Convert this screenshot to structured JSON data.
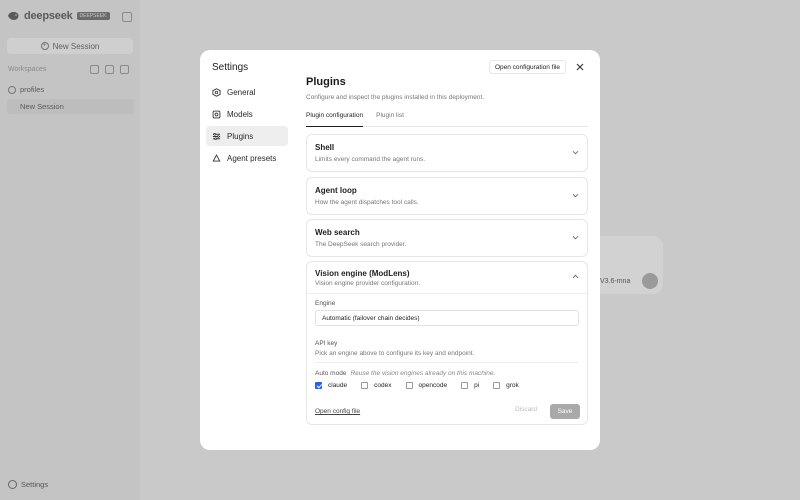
{
  "app": {
    "brand_name": "deepseek",
    "brand_badge": "DEEPSEEK",
    "new_session_label": "New Session",
    "workspaces_label": "Workspaces",
    "workspace_name": "profiles",
    "session_name": "New Session",
    "bottom_settings_label": "Settings",
    "bg_model_label": "V3.6-mna"
  },
  "modal": {
    "title": "Settings",
    "nav": [
      {
        "label": "General",
        "icon": "hexagon-icon"
      },
      {
        "label": "Models",
        "icon": "cube-icon"
      },
      {
        "label": "Plugins",
        "icon": "sliders-icon",
        "active": true
      },
      {
        "label": "Agent presets",
        "icon": "recycle-icon"
      }
    ],
    "open_config_label": "Open configuration file",
    "page_title": "Plugins",
    "page_subtitle": "Configure and inspect the plugins installed in this deployment.",
    "tabs": [
      {
        "label": "Plugin configuration",
        "active": true
      },
      {
        "label": "Plugin list",
        "active": false
      }
    ],
    "cards": [
      {
        "title": "Shell",
        "desc": "Limits every command the agent runs."
      },
      {
        "title": "Agent loop",
        "desc": "How the agent dispatches tool calls."
      },
      {
        "title": "Web search",
        "desc": "The DeepSeek search provider."
      }
    ],
    "vision": {
      "title": "Vision engine (ModLens)",
      "desc": "Vision engine provider configuration.",
      "engine_label": "Engine",
      "engine_value": "Automatic (failover chain decides)",
      "api_label": "API key",
      "api_desc": "Pick an engine above to configure its key and endpoint.",
      "auto_label": "Auto mode",
      "auto_hint": "Reuse the vision engines already on this machine.",
      "options": [
        {
          "label": "claude",
          "checked": true
        },
        {
          "label": "codex",
          "checked": false
        },
        {
          "label": "opencode",
          "checked": false
        },
        {
          "label": "pi",
          "checked": false
        },
        {
          "label": "grok",
          "checked": false
        }
      ],
      "open_config_link": "Open config file",
      "discard_label": "Discard",
      "save_label": "Save"
    }
  }
}
